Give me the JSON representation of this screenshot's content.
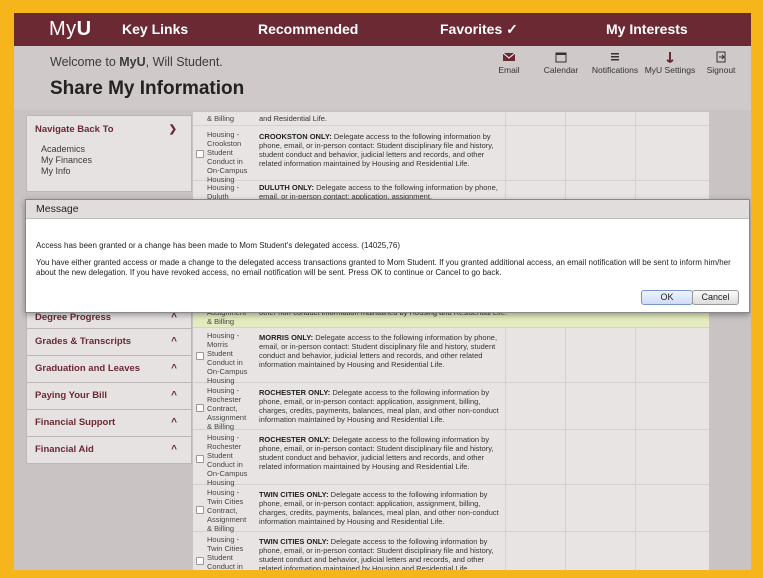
{
  "nav": {
    "logo_prefix": "My",
    "logo_suffix": "U",
    "items": [
      "Key Links",
      "Recommended",
      "Favorites ✓",
      "My Interests"
    ]
  },
  "header": {
    "welcome_prefix": "Welcome to ",
    "welcome_brand": "MyU",
    "welcome_suffix": ", Will Student.",
    "title": "Share My Information",
    "tools": [
      "Email",
      "Calendar",
      "Notifications",
      "MyU Settings",
      "Signout"
    ]
  },
  "sidebar": {
    "navigate_back": "Navigate Back To",
    "links": [
      "Academics",
      "My Finances",
      "My Info"
    ],
    "sections": [
      "Degree Progress",
      "Grades & Transcripts",
      "Graduation and Leaves",
      "Paying Your Bill",
      "Financial Support",
      "Financial Aid"
    ]
  },
  "rows": [
    {
      "col1": "& Billing",
      "col2": "and Residential Life."
    },
    {
      "col1": "Housing - Crookston Student Conduct in On-Campus Housing",
      "col2_bold": "CROOKSTON ONLY:",
      "col2": " Delegate access to the following information by phone, email, or in-person contact: Student disciplinary file and history, student conduct and behavior, judicial letters and records, and other related information maintained by Housing and Residential Life."
    },
    {
      "col1": "Housing - Duluth",
      "col2_bold": "DULUTH ONLY:",
      "col2": " Delegate access to the following information by phone, email, or in-person contact: application, assignment,"
    },
    {
      "col1": "Assignment & Billing",
      "col2": "other non-conduct information maintained by Housing and Residential Life."
    },
    {
      "col1": "Housing - Morris Student Conduct in On-Campus Housing",
      "col2_bold": "MORRIS ONLY:",
      "col2": " Delegate access to the following information by phone, email, or in-person contact: Student disciplinary file and history, student conduct and behavior, judicial letters and records, and other related information maintained by Housing and Residential Life."
    },
    {
      "col1": "Housing - Rochester Contract, Assignment & Billing",
      "col2_bold": "ROCHESTER ONLY:",
      "col2": " Delegate access to the following information by phone, email, or in-person contact: application, assignment, billing, charges, credits, payments, balances, meal plan, and other non-conduct information maintained by Housing and Residential Life."
    },
    {
      "col1": "Housing - Rochester Student Conduct in On-Campus Housing",
      "col2_bold": "ROCHESTER ONLY:",
      "col2": " Delegate access to the following information by phone, email, or in-person contact: Student disciplinary file and history, student conduct and behavior, judicial letters and records, and other related information maintained by Housing and Residential Life."
    },
    {
      "col1": "Housing - Twin Cities Contract, Assignment & Billing",
      "col2_bold": "TWIN CITIES ONLY:",
      "col2": " Delegate access to the following information by phone, email, or in-person contact: application, assignment, billing, charges, credits, payments, balances, meal plan, and other non-conduct information maintained by Housing and Residential Life."
    },
    {
      "col1": "Housing - Twin Cities Student Conduct in On-Campus Housing",
      "col2_bold": "TWIN CITIES ONLY:",
      "col2": " Delegate access to the following information by phone, email, or in-person contact: Student disciplinary file and history, student conduct and behavior, judicial letters and records, and other related information maintained by Housing and Residential Life."
    }
  ],
  "modal": {
    "title": "Message",
    "message1": "Access has been granted or a change has been made to Mom Student's delegated access. (14025,76)",
    "message2": "You have either granted access or made a change to the delegated access transactions granted to Mom Student. If you granted additional access, an email notification will be sent to inform him/her about the new delegation. If you have revoked access, no email notification will be sent. Press OK to continue or Cancel to go back.",
    "ok_label": "OK",
    "cancel_label": "Cancel"
  },
  "colors": {
    "maroon": "#6b2934",
    "gold": "#f6b51a",
    "highlight_row": "#e4ecbf"
  }
}
